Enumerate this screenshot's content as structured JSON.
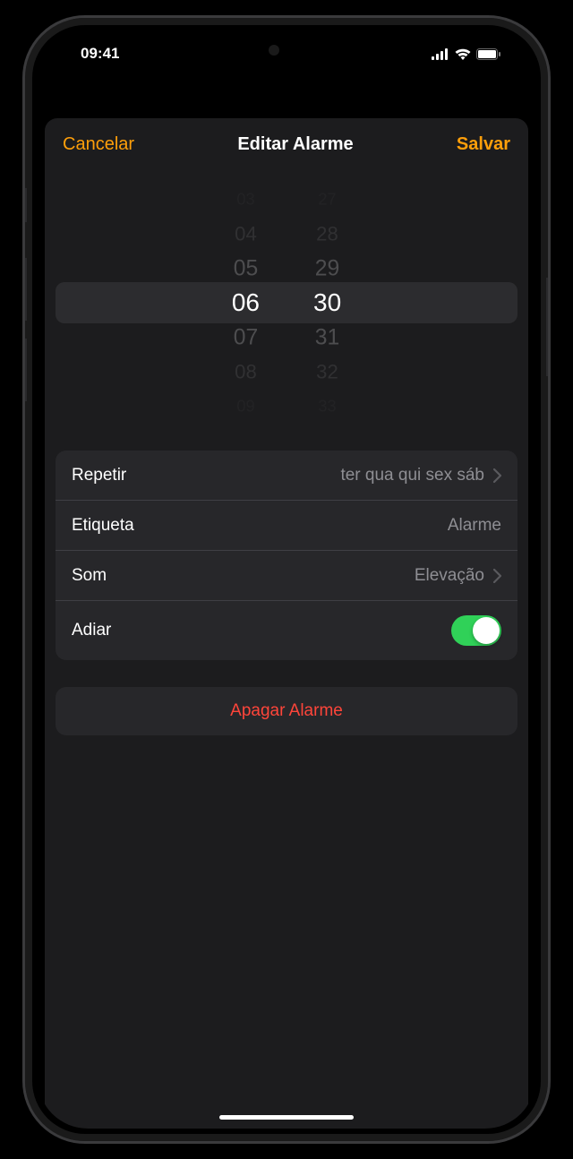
{
  "status": {
    "time": "09:41"
  },
  "modal": {
    "cancel": "Cancelar",
    "title": "Editar Alarme",
    "save": "Salvar"
  },
  "picker": {
    "hours": [
      "03",
      "04",
      "05",
      "06",
      "07",
      "08",
      "09"
    ],
    "minutes": [
      "27",
      "28",
      "29",
      "30",
      "31",
      "32",
      "33"
    ],
    "selected_hour": "06",
    "selected_minute": "30"
  },
  "settings": {
    "repeat": {
      "label": "Repetir",
      "value": "ter qua qui sex sáb"
    },
    "tag": {
      "label": "Etiqueta",
      "value": "Alarme"
    },
    "sound": {
      "label": "Som",
      "value": "Elevação"
    },
    "snooze": {
      "label": "Adiar",
      "on": true
    }
  },
  "delete": {
    "label": "Apagar Alarme"
  }
}
